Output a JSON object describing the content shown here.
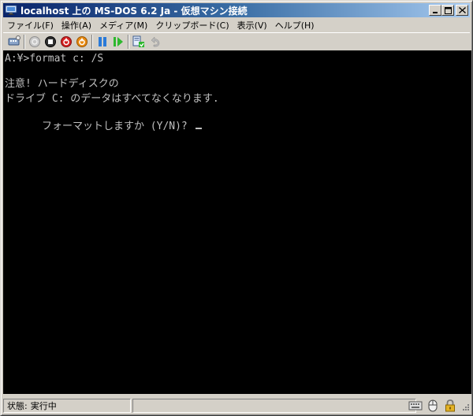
{
  "window": {
    "title": "localhost 上の MS-DOS 6.2 Ja  - 仮想マシン接続",
    "controls": {
      "minimize": "_",
      "maximize": "□",
      "close": "×"
    }
  },
  "menu": {
    "items": [
      {
        "label": "ファイル(F)"
      },
      {
        "label": "操作(A)"
      },
      {
        "label": "メディア(M)"
      },
      {
        "label": "クリップボード(C)"
      },
      {
        "label": "表示(V)"
      },
      {
        "label": "ヘルプ(H)"
      }
    ]
  },
  "toolbar": {
    "buttons": [
      {
        "icon": "ctrl-alt-del-icon"
      },
      {
        "icon": "start-icon"
      },
      {
        "icon": "turn-off-icon"
      },
      {
        "icon": "shutdown-icon"
      },
      {
        "icon": "power-icon"
      },
      {
        "icon": "pause-icon"
      },
      {
        "icon": "resume-icon"
      },
      {
        "icon": "snapshot-icon"
      },
      {
        "icon": "revert-icon"
      }
    ]
  },
  "console": {
    "lines": [
      "A:¥>format c: /S",
      "",
      "注意! ハードディスクの",
      "ドライブ C: のデータはすべてなくなります.",
      "フォーマットしますか (Y/N)? "
    ]
  },
  "status": {
    "label": "状態:",
    "value": "実行中",
    "colors": {
      "console_bg": "#000000",
      "console_fg": "#c0c0c0"
    }
  }
}
